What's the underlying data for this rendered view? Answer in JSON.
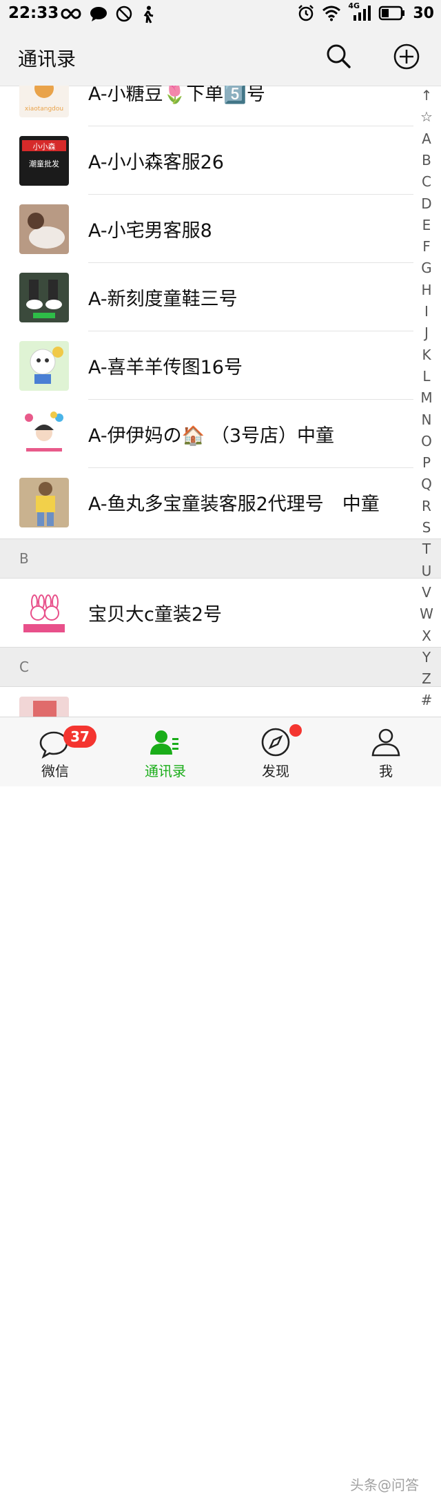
{
  "status_bar": {
    "time": "22:33",
    "network": "4G",
    "battery": "30"
  },
  "header": {
    "title": "通讯录",
    "search_icon": "search-icon",
    "add_icon": "plus-circle-icon"
  },
  "contacts": [
    {
      "name": "A-小糖豆🌷下单5️⃣号",
      "avatar_colors": [
        "#f7f1ea",
        "#e9a34a"
      ]
    },
    {
      "name": "A-小小森客服26",
      "avatar_colors": [
        "#1b1b1b",
        "#d62a2a"
      ]
    },
    {
      "name": "A-小宅男客服8",
      "avatar_colors": [
        "#b89a84",
        "#efe9e4"
      ]
    },
    {
      "name": "A-新刻度童鞋三号",
      "avatar_colors": [
        "#3b4a3c",
        "#ffffff"
      ]
    },
    {
      "name": "A-喜羊羊传图16号",
      "avatar_colors": [
        "#dff3d4",
        "#f0c948"
      ]
    },
    {
      "name": "A-伊伊妈の🏠 （3号店）中童",
      "avatar_colors": [
        "#ffffff",
        "#e85a8a"
      ]
    },
    {
      "name": "A-鱼丸多宝童装客服2代理号　中童",
      "avatar_colors": [
        "#c9b28f",
        "#f2d04a"
      ]
    }
  ],
  "section_b": {
    "letter": "B",
    "contacts": [
      {
        "name": "宝贝大c童装2号",
        "avatar_colors": [
          "#ffffff",
          "#e8508a"
        ]
      }
    ]
  },
  "section_c": {
    "letter": "C",
    "partial_name": "C"
  },
  "index_letters": [
    "↑",
    "☆",
    "A",
    "B",
    "C",
    "D",
    "E",
    "F",
    "G",
    "H",
    "I",
    "J",
    "K",
    "L",
    "M",
    "N",
    "O",
    "P",
    "Q",
    "R",
    "S",
    "T",
    "U",
    "V",
    "W",
    "X",
    "Y",
    "Z",
    "#"
  ],
  "tabs": [
    {
      "label": "微信",
      "icon": "chat-bubble-icon",
      "badge": "37"
    },
    {
      "label": "通讯录",
      "icon": "contacts-icon",
      "active": true
    },
    {
      "label": "发现",
      "icon": "compass-icon",
      "dot": true
    },
    {
      "label": "我",
      "icon": "person-icon"
    }
  ],
  "watermark": "头条@问答",
  "colors": {
    "accent": "#1aad19",
    "badge": "#f43530"
  }
}
